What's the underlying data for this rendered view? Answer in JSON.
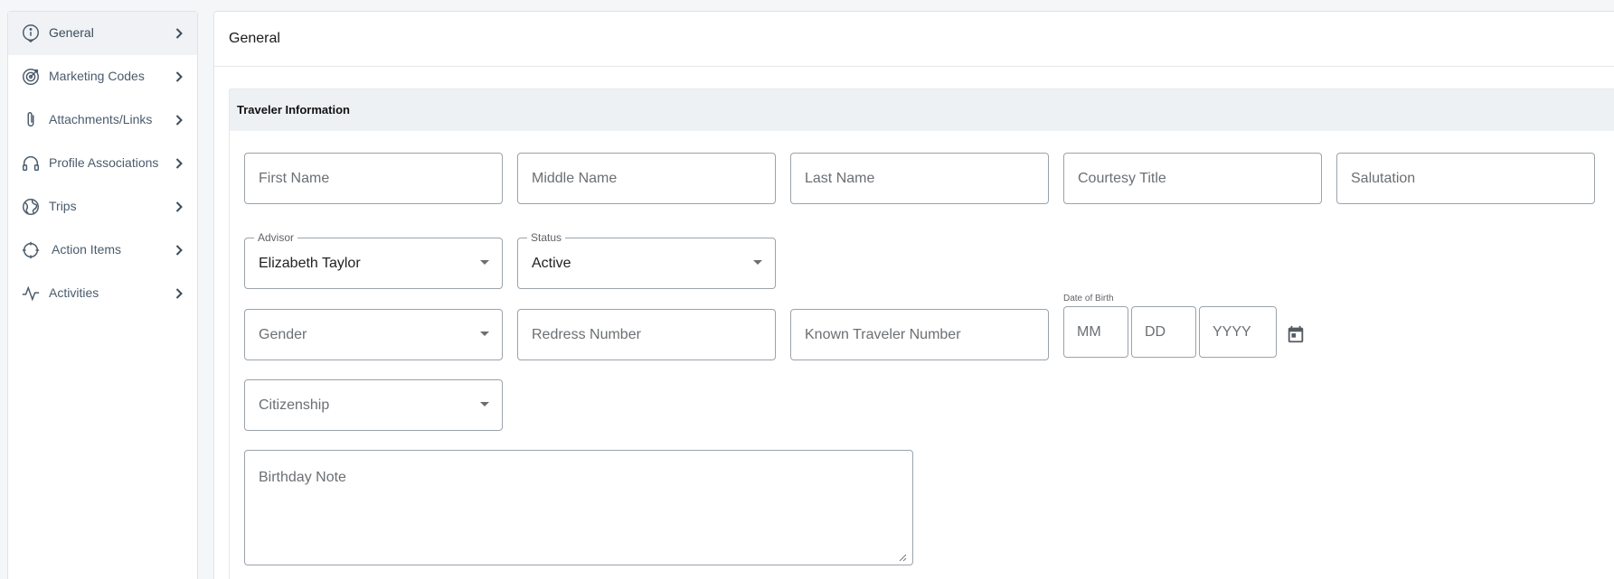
{
  "sidebar": {
    "items": [
      {
        "label": "General",
        "icon": "info-circle-icon",
        "active": true
      },
      {
        "label": "Marketing Codes",
        "icon": "target-icon",
        "active": false
      },
      {
        "label": "Attachments/Links",
        "icon": "paperclip-icon",
        "active": false
      },
      {
        "label": "Profile Associations",
        "icon": "headphones-icon",
        "active": false
      },
      {
        "label": "Trips",
        "icon": "globe-icon",
        "active": false
      },
      {
        "label": "Action Items",
        "icon": "crosshair-icon",
        "active": false
      },
      {
        "label": "Activities",
        "icon": "activity-pulse-icon",
        "active": false
      }
    ]
  },
  "main": {
    "title": "General",
    "section_title": "Traveler Information",
    "fields": {
      "first_name": {
        "placeholder": "First Name"
      },
      "middle_name": {
        "placeholder": "Middle Name"
      },
      "last_name": {
        "placeholder": "Last Name"
      },
      "courtesy_title": {
        "placeholder": "Courtesy Title"
      },
      "salutation": {
        "placeholder": "Salutation"
      },
      "advisor": {
        "label": "Advisor",
        "value": "Elizabeth Taylor"
      },
      "status": {
        "label": "Status",
        "value": "Active"
      },
      "gender": {
        "placeholder": "Gender"
      },
      "redress_number": {
        "placeholder": "Redress Number"
      },
      "known_traveler_number": {
        "placeholder": "Known Traveler Number"
      },
      "dob": {
        "label": "Date of Birth",
        "mm": "MM",
        "dd": "DD",
        "yyyy": "YYYY"
      },
      "citizenship": {
        "placeholder": "Citizenship"
      },
      "birthday_note": {
        "placeholder": "Birthday Note"
      }
    }
  },
  "colors": {
    "border": "#9aa3ab",
    "section_header_bg": "#eef1f4",
    "sidebar_active_bg": "#f0f2f5",
    "sidebar_text": "#4a5b6c",
    "page_bg": "#f4f6f8"
  }
}
